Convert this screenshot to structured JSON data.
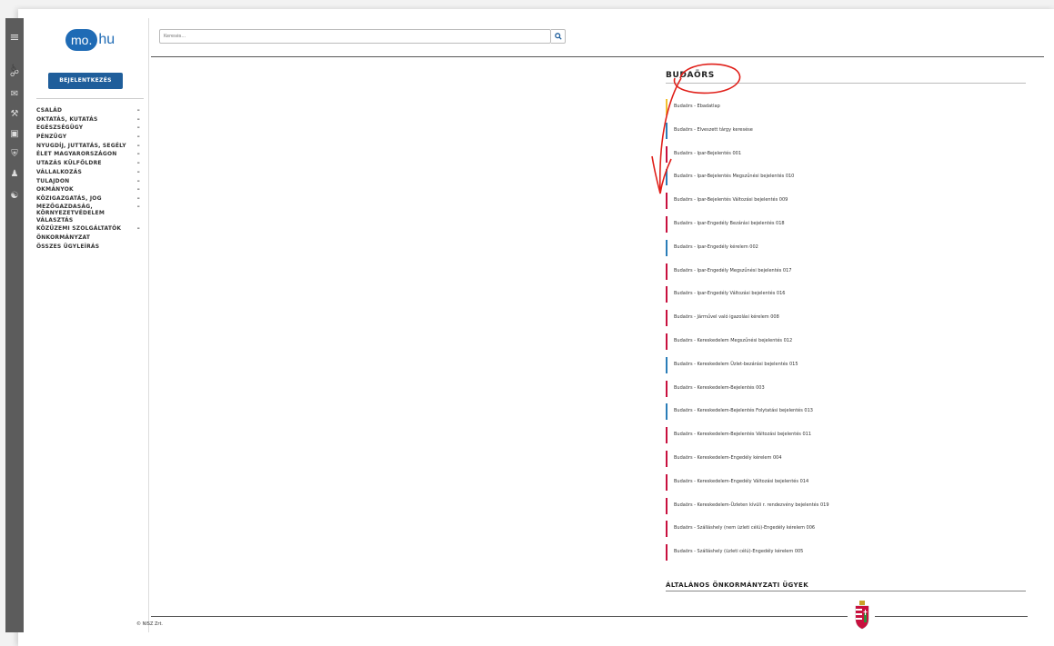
{
  "logo": {
    "circle_text": "mo.",
    "rest_text": "hu"
  },
  "login_label": "BEJELENTKEZÉS",
  "categories": [
    {
      "label": "CSALÁD",
      "expand": "–"
    },
    {
      "label": "OKTATÁS, KUTATÁS",
      "expand": "–"
    },
    {
      "label": "EGÉSZSÉGÜGY",
      "expand": "–"
    },
    {
      "label": "PÉNZÜGY",
      "expand": "–"
    },
    {
      "label": "NYUGDÍJ, JUTTATÁS, SEGÉLY",
      "expand": "–"
    },
    {
      "label": "ÉLET MAGYARORSZÁGON",
      "expand": "–"
    },
    {
      "label": "UTAZÁS KÜLFÖLDRE",
      "expand": "–"
    },
    {
      "label": "VÁLLALKOZÁS",
      "expand": "–"
    },
    {
      "label": "TULAJDON",
      "expand": "–"
    },
    {
      "label": "OKMÁNYOK",
      "expand": "–"
    },
    {
      "label": "KÖZIGAZGATÁS, JOG",
      "expand": "–"
    },
    {
      "label": "MEZŐGAZDASÁG, KÖRNYEZETVÉDELEM",
      "expand": "–"
    },
    {
      "label": "VÁLASZTÁS",
      "expand": ""
    },
    {
      "label": "KÖZÜZEMI SZOLGÁLTATÓK",
      "expand": "–"
    },
    {
      "label": "ÖNKORMÁNYZAT",
      "expand": ""
    },
    {
      "label": "ÖSSZES ÜGYLEÍRÁS",
      "expand": ""
    }
  ],
  "search": {
    "placeholder": "Keresés..."
  },
  "region_title": "BUDAÖRS",
  "colors": {
    "yellow": "#f2c230",
    "blue": "#2a7db8",
    "red": "#c8103e",
    "brand": "#1f6bb5"
  },
  "items": [
    {
      "label": "Budaörs - Ebadatlap",
      "color": "yellow"
    },
    {
      "label": "Budaörs - Elveszett tárgy keresése",
      "color": "blue"
    },
    {
      "label": "Budaörs - Ipar-Bejelentés 001",
      "color": "red"
    },
    {
      "label": "Budaörs - Ipar-Bejelentés Megszűnési bejelentés 010",
      "color": "blue"
    },
    {
      "label": "Budaörs - Ipar-Bejelentés Változási bejelentés 009",
      "color": "red"
    },
    {
      "label": "Budaörs - Ipar-Engedély Bezárási bejelentés 018",
      "color": "red"
    },
    {
      "label": "Budaörs - Ipar-Engedély kérelem 002",
      "color": "blue"
    },
    {
      "label": "Budaörs - Ipar-Engedély Megszűnési bejelentés 017",
      "color": "red"
    },
    {
      "label": "Budaörs - Ipar-Engedély Változási bejelentés 016",
      "color": "red"
    },
    {
      "label": "Budaörs - Járművel való igazolási kérelem 008",
      "color": "red"
    },
    {
      "label": "Budaörs - Kereskedelem Megszűnési bejelentés 012",
      "color": "red"
    },
    {
      "label": "Budaörs - Kereskedelem Üzlet-bezárási bejelentés 015",
      "color": "blue"
    },
    {
      "label": "Budaörs - Kereskedelem-Bejelentés 003",
      "color": "red"
    },
    {
      "label": "Budaörs - Kereskedelem-Bejelentés Folytatási bejelentés 013",
      "color": "blue"
    },
    {
      "label": "Budaörs - Kereskedelem-Bejelentés Változási bejelentés 011",
      "color": "red"
    },
    {
      "label": "Budaörs - Kereskedelem-Engedély kérelem 004",
      "color": "red"
    },
    {
      "label": "Budaörs - Kereskedelem-Engedély Változási bejelentés 014",
      "color": "red"
    },
    {
      "label": "Budaörs - Kereskedelem-Üzleten kívüli r. rendezvény bejelentés 019",
      "color": "red"
    },
    {
      "label": "Budaörs - Szálláshely (nem üzleti célú)-Engedély kérelem 006",
      "color": "red"
    },
    {
      "label": "Budaörs - Szálláshely (üzleti célú)-Engedély kérelem 005",
      "color": "red"
    }
  ],
  "section2_title": "ÁLTALÁNOS ÖNKORMÁNYZATI ÜGYEK",
  "footer": {
    "copyright": "© NISZ Zrt."
  },
  "rail_icons": [
    "menu-icon",
    "accessibility-icon",
    "lock-icon",
    "mail-icon",
    "wrench-icon",
    "card-icon",
    "shield-icon",
    "people-icon",
    "globe-icon"
  ]
}
